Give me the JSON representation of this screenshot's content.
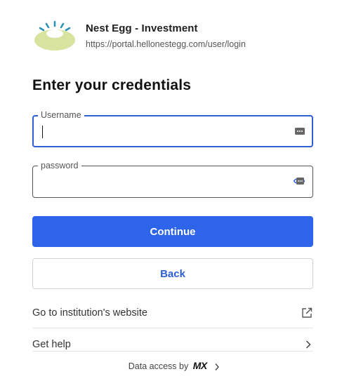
{
  "institution": {
    "name": "Nest Egg - Investment",
    "url": "https://portal.hellonestegg.com/user/login"
  },
  "form": {
    "title": "Enter your credentials",
    "username": {
      "label": "Username",
      "value": ""
    },
    "password": {
      "label": "password",
      "value": ""
    }
  },
  "buttons": {
    "continue": "Continue",
    "back": "Back"
  },
  "links": {
    "institution_website": "Go to institution's website",
    "get_help": "Get help"
  },
  "footer": {
    "prefix": "Data access by",
    "brand": "MX"
  },
  "colors": {
    "accent": "#2d64ea",
    "focus_border": "#2d5ed6",
    "logo_green": "#d8e3a0",
    "logo_blue": "#2a8fb5"
  },
  "icons": {
    "logo": "nest-egg-logo",
    "username_field": "password-manager-icon",
    "password_field": "password-manager-icon",
    "external": "external-link-icon",
    "help": "chevron-right-icon",
    "footer": "chevron-right-icon"
  }
}
